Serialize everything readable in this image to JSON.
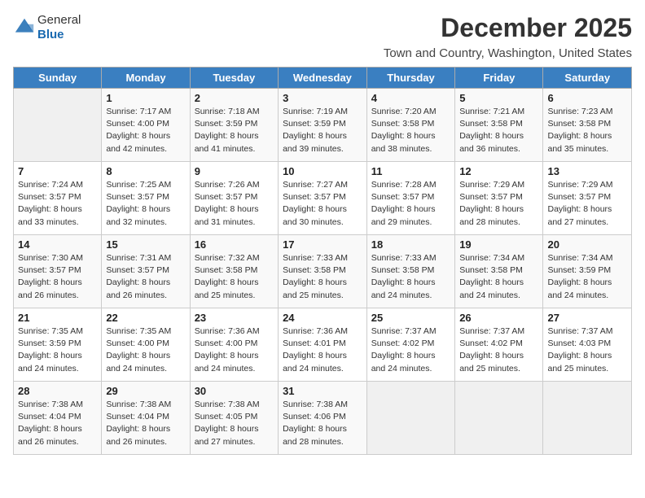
{
  "header": {
    "logo_line1": "General",
    "logo_line2": "Blue",
    "month_title": "December 2025",
    "subtitle": "Town and Country, Washington, United States"
  },
  "weekdays": [
    "Sunday",
    "Monday",
    "Tuesday",
    "Wednesday",
    "Thursday",
    "Friday",
    "Saturday"
  ],
  "weeks": [
    [
      {
        "day": "",
        "info": ""
      },
      {
        "day": "1",
        "info": "Sunrise: 7:17 AM\nSunset: 4:00 PM\nDaylight: 8 hours\nand 42 minutes."
      },
      {
        "day": "2",
        "info": "Sunrise: 7:18 AM\nSunset: 3:59 PM\nDaylight: 8 hours\nand 41 minutes."
      },
      {
        "day": "3",
        "info": "Sunrise: 7:19 AM\nSunset: 3:59 PM\nDaylight: 8 hours\nand 39 minutes."
      },
      {
        "day": "4",
        "info": "Sunrise: 7:20 AM\nSunset: 3:58 PM\nDaylight: 8 hours\nand 38 minutes."
      },
      {
        "day": "5",
        "info": "Sunrise: 7:21 AM\nSunset: 3:58 PM\nDaylight: 8 hours\nand 36 minutes."
      },
      {
        "day": "6",
        "info": "Sunrise: 7:23 AM\nSunset: 3:58 PM\nDaylight: 8 hours\nand 35 minutes."
      }
    ],
    [
      {
        "day": "7",
        "info": "Sunrise: 7:24 AM\nSunset: 3:57 PM\nDaylight: 8 hours\nand 33 minutes."
      },
      {
        "day": "8",
        "info": "Sunrise: 7:25 AM\nSunset: 3:57 PM\nDaylight: 8 hours\nand 32 minutes."
      },
      {
        "day": "9",
        "info": "Sunrise: 7:26 AM\nSunset: 3:57 PM\nDaylight: 8 hours\nand 31 minutes."
      },
      {
        "day": "10",
        "info": "Sunrise: 7:27 AM\nSunset: 3:57 PM\nDaylight: 8 hours\nand 30 minutes."
      },
      {
        "day": "11",
        "info": "Sunrise: 7:28 AM\nSunset: 3:57 PM\nDaylight: 8 hours\nand 29 minutes."
      },
      {
        "day": "12",
        "info": "Sunrise: 7:29 AM\nSunset: 3:57 PM\nDaylight: 8 hours\nand 28 minutes."
      },
      {
        "day": "13",
        "info": "Sunrise: 7:29 AM\nSunset: 3:57 PM\nDaylight: 8 hours\nand 27 minutes."
      }
    ],
    [
      {
        "day": "14",
        "info": "Sunrise: 7:30 AM\nSunset: 3:57 PM\nDaylight: 8 hours\nand 26 minutes."
      },
      {
        "day": "15",
        "info": "Sunrise: 7:31 AM\nSunset: 3:57 PM\nDaylight: 8 hours\nand 26 minutes."
      },
      {
        "day": "16",
        "info": "Sunrise: 7:32 AM\nSunset: 3:58 PM\nDaylight: 8 hours\nand 25 minutes."
      },
      {
        "day": "17",
        "info": "Sunrise: 7:33 AM\nSunset: 3:58 PM\nDaylight: 8 hours\nand 25 minutes."
      },
      {
        "day": "18",
        "info": "Sunrise: 7:33 AM\nSunset: 3:58 PM\nDaylight: 8 hours\nand 24 minutes."
      },
      {
        "day": "19",
        "info": "Sunrise: 7:34 AM\nSunset: 3:58 PM\nDaylight: 8 hours\nand 24 minutes."
      },
      {
        "day": "20",
        "info": "Sunrise: 7:34 AM\nSunset: 3:59 PM\nDaylight: 8 hours\nand 24 minutes."
      }
    ],
    [
      {
        "day": "21",
        "info": "Sunrise: 7:35 AM\nSunset: 3:59 PM\nDaylight: 8 hours\nand 24 minutes."
      },
      {
        "day": "22",
        "info": "Sunrise: 7:35 AM\nSunset: 4:00 PM\nDaylight: 8 hours\nand 24 minutes."
      },
      {
        "day": "23",
        "info": "Sunrise: 7:36 AM\nSunset: 4:00 PM\nDaylight: 8 hours\nand 24 minutes."
      },
      {
        "day": "24",
        "info": "Sunrise: 7:36 AM\nSunset: 4:01 PM\nDaylight: 8 hours\nand 24 minutes."
      },
      {
        "day": "25",
        "info": "Sunrise: 7:37 AM\nSunset: 4:02 PM\nDaylight: 8 hours\nand 24 minutes."
      },
      {
        "day": "26",
        "info": "Sunrise: 7:37 AM\nSunset: 4:02 PM\nDaylight: 8 hours\nand 25 minutes."
      },
      {
        "day": "27",
        "info": "Sunrise: 7:37 AM\nSunset: 4:03 PM\nDaylight: 8 hours\nand 25 minutes."
      }
    ],
    [
      {
        "day": "28",
        "info": "Sunrise: 7:38 AM\nSunset: 4:04 PM\nDaylight: 8 hours\nand 26 minutes."
      },
      {
        "day": "29",
        "info": "Sunrise: 7:38 AM\nSunset: 4:04 PM\nDaylight: 8 hours\nand 26 minutes."
      },
      {
        "day": "30",
        "info": "Sunrise: 7:38 AM\nSunset: 4:05 PM\nDaylight: 8 hours\nand 27 minutes."
      },
      {
        "day": "31",
        "info": "Sunrise: 7:38 AM\nSunset: 4:06 PM\nDaylight: 8 hours\nand 28 minutes."
      },
      {
        "day": "",
        "info": ""
      },
      {
        "day": "",
        "info": ""
      },
      {
        "day": "",
        "info": ""
      }
    ]
  ]
}
